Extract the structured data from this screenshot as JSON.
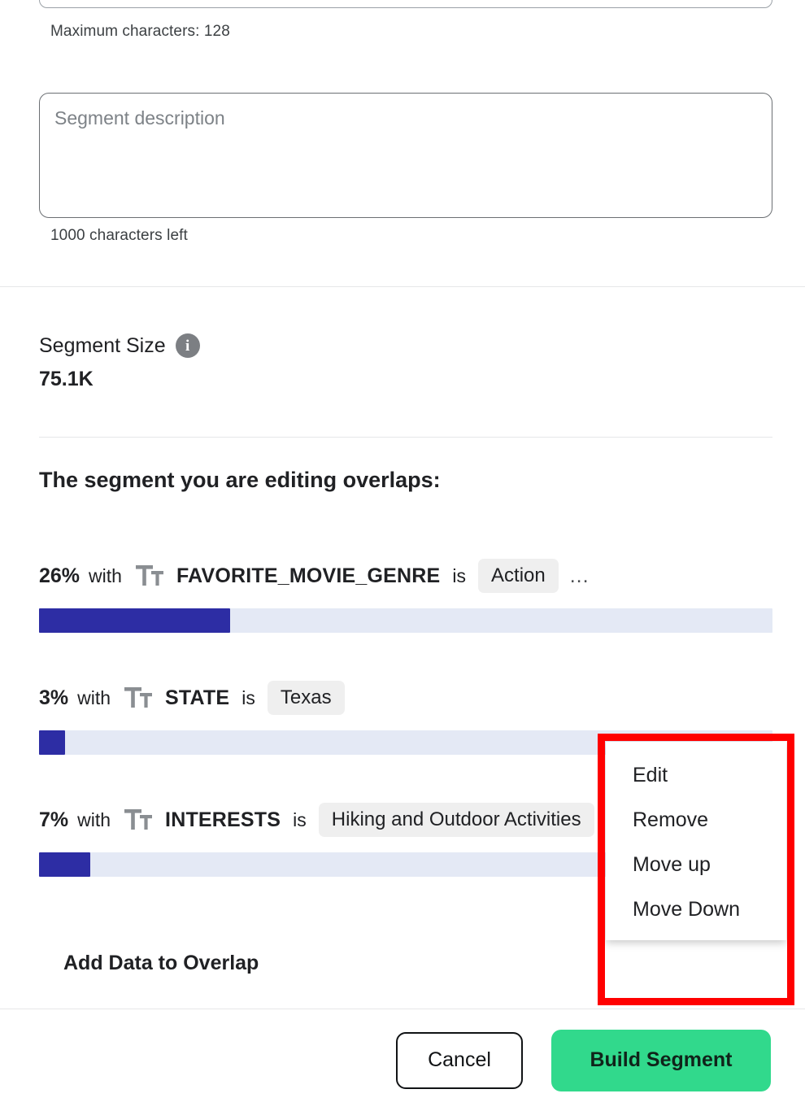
{
  "form": {
    "name_input": {
      "value": "",
      "placeholder": ""
    },
    "name_helper": "Maximum characters: 128",
    "description_input": {
      "value": "",
      "placeholder": "Segment description"
    },
    "description_helper": "1000 characters left"
  },
  "segment_size": {
    "label": "Segment Size",
    "info_icon": "info-icon",
    "value": "75.1K"
  },
  "overlap": {
    "heading": "The segment you are editing overlaps:",
    "add_link": "Add Data to Overlap",
    "rows": [
      {
        "percent": "26%",
        "with": "with",
        "type_icon": "text-type-icon",
        "field": "FAVORITE_MOVIE_GENRE",
        "is": "is",
        "chip": "Action",
        "more": "...",
        "bar_value": 26
      },
      {
        "percent": "3%",
        "with": "with",
        "type_icon": "text-type-icon",
        "field": "STATE",
        "is": "is",
        "chip": "Texas",
        "more": "",
        "bar_value": 3
      },
      {
        "percent": "7%",
        "with": "with",
        "type_icon": "text-type-icon",
        "field": "INTERESTS",
        "is": "is",
        "chip": "Hiking and Outdoor Activities",
        "more": "",
        "bar_value": 7
      }
    ]
  },
  "context_menu": {
    "items": [
      "Edit",
      "Remove",
      "Move up",
      "Move Down"
    ],
    "highlight_color": "#ff0000"
  },
  "footer": {
    "cancel_label": "Cancel",
    "build_label": "Build Segment"
  },
  "colors": {
    "bar_fill": "#2d2da4",
    "bar_track": "#e4e9f5",
    "primary_button": "#31d98c",
    "chip_bg": "#efefef",
    "highlight": "#ff0000"
  }
}
